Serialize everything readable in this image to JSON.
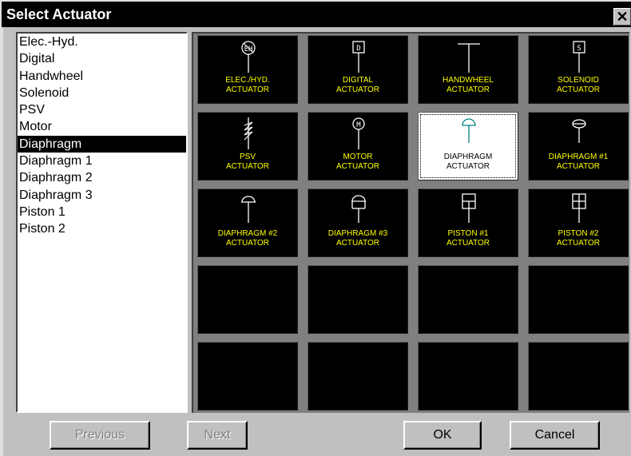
{
  "window": {
    "title": "Select Actuator",
    "close_glyph": "✕"
  },
  "list": {
    "items": [
      "Elec.-Hyd.",
      "Digital",
      "Handwheel",
      "Solenoid",
      "PSV",
      "Motor",
      "Diaphragm",
      "Diaphragm 1",
      "Diaphragm 2",
      "Diaphragm 3",
      "Piston 1",
      "Piston 2"
    ],
    "selected": "Diaphragm"
  },
  "tiles": [
    {
      "label": "ELEC./HYD.\nACTUATOR",
      "icon": "elec-hyd-actuator-icon"
    },
    {
      "label": "DIGITAL\nACTUATOR",
      "icon": "digital-actuator-icon"
    },
    {
      "label": "HANDWHEEL\nACTUATOR",
      "icon": "handwheel-actuator-icon"
    },
    {
      "label": "SOLENOID\nACTUATOR",
      "icon": "solenoid-actuator-icon"
    },
    {
      "label": "PSV\nACTUATOR",
      "icon": "psv-actuator-icon"
    },
    {
      "label": "MOTOR\nACTUATOR",
      "icon": "motor-actuator-icon"
    },
    {
      "label": "DIAPHRAGM\nACTUATOR",
      "icon": "diaphragm-actuator-icon",
      "selected": true
    },
    {
      "label": "DIAPHRAGM  #1\nACTUATOR",
      "icon": "diaphragm-1-actuator-icon"
    },
    {
      "label": "DIAPHRAGM  #2\nACTUATOR",
      "icon": "diaphragm-2-actuator-icon"
    },
    {
      "label": "DIAPHRAGM  #3\nACTUATOR",
      "icon": "diaphragm-3-actuator-icon"
    },
    {
      "label": "PISTON  #1\nACTUATOR",
      "icon": "piston-1-actuator-icon"
    },
    {
      "label": "PISTON  #2\nACTUATOR",
      "icon": "piston-2-actuator-icon"
    },
    {
      "label": "",
      "icon": ""
    },
    {
      "label": "",
      "icon": ""
    },
    {
      "label": "",
      "icon": ""
    },
    {
      "label": "",
      "icon": ""
    },
    {
      "label": "",
      "icon": ""
    },
    {
      "label": "",
      "icon": ""
    },
    {
      "label": "",
      "icon": ""
    },
    {
      "label": "",
      "icon": ""
    }
  ],
  "buttons": {
    "previous": "Previous",
    "next": "Next",
    "ok": "OK",
    "cancel": "Cancel"
  },
  "colors": {
    "tile_background": "#000000",
    "tile_label": "#ffff00",
    "symbol_line": "#ffffff",
    "selected_symbol": "#008080"
  }
}
